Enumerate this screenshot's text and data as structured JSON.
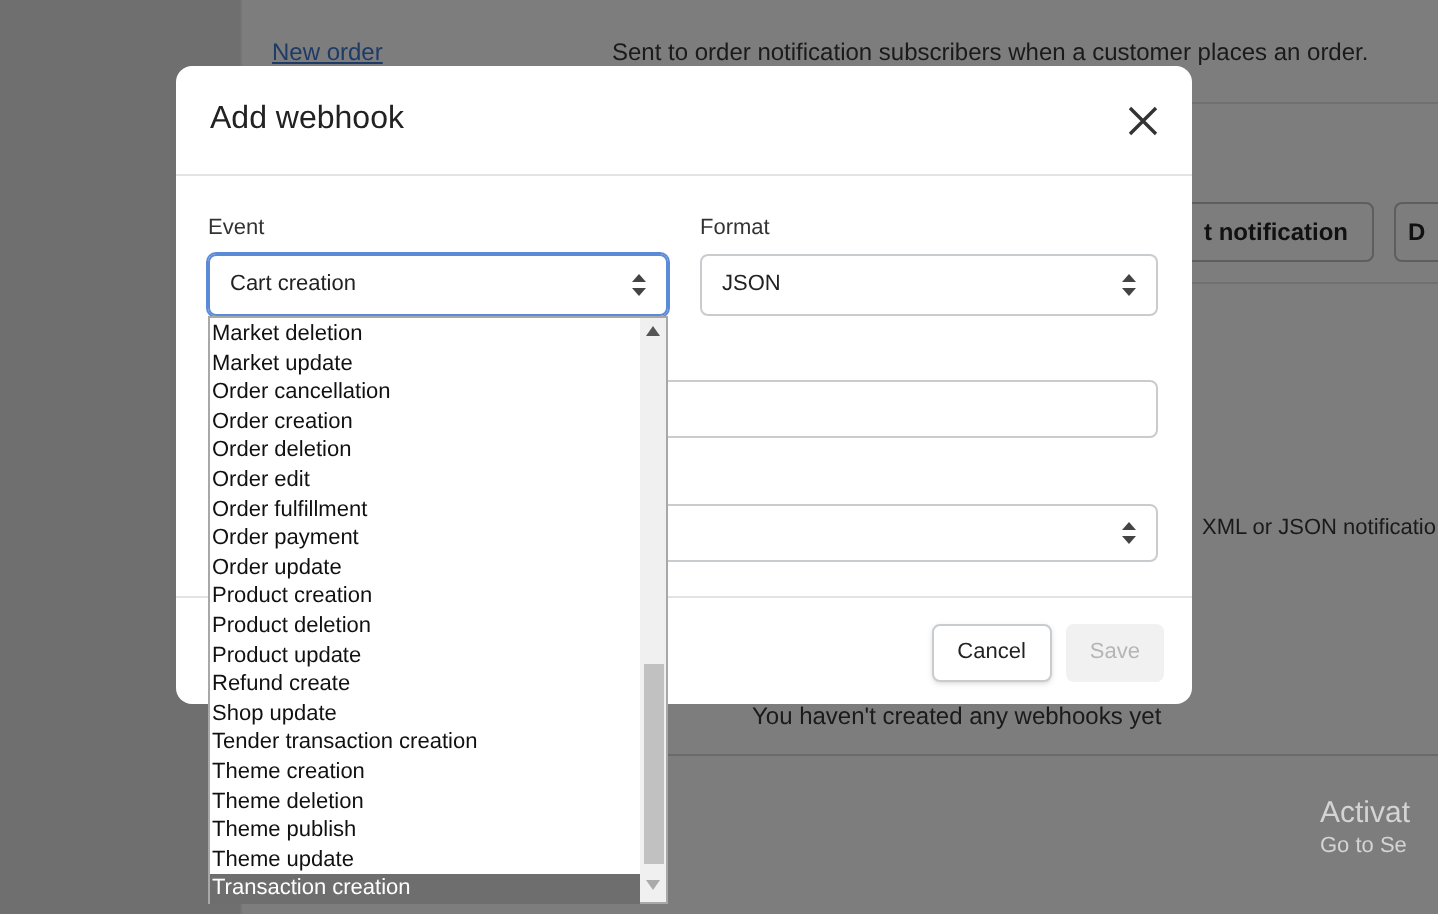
{
  "background": {
    "link": "New order",
    "description": "Sent to order notification subscribers when a customer places an order.",
    "button_1": "t notification",
    "button_2": "D",
    "format_note": "XML or JSON notificatio",
    "empty_state": "You haven't created any webhooks yet"
  },
  "dialog": {
    "title": "Add webhook",
    "event": {
      "label": "Event",
      "value": "Cart creation",
      "focused": true
    },
    "format": {
      "label": "Format",
      "value": "JSON"
    },
    "buttons": [
      {
        "label": "Cancel",
        "disabled": false
      },
      {
        "label": "Save",
        "disabled": true
      }
    ]
  },
  "event_options": [
    {
      "label": "Market deletion",
      "selected": false
    },
    {
      "label": "Market update",
      "selected": false
    },
    {
      "label": "Order cancellation",
      "selected": false
    },
    {
      "label": "Order creation",
      "selected": false
    },
    {
      "label": "Order deletion",
      "selected": false
    },
    {
      "label": "Order edit",
      "selected": false
    },
    {
      "label": "Order fulfillment",
      "selected": false
    },
    {
      "label": "Order payment",
      "selected": false
    },
    {
      "label": "Order update",
      "selected": false
    },
    {
      "label": "Product creation",
      "selected": false
    },
    {
      "label": "Product deletion",
      "selected": false
    },
    {
      "label": "Product update",
      "selected": false
    },
    {
      "label": "Refund create",
      "selected": false
    },
    {
      "label": "Shop update",
      "selected": false
    },
    {
      "label": "Tender transaction creation",
      "selected": false
    },
    {
      "label": "Theme creation",
      "selected": false
    },
    {
      "label": "Theme deletion",
      "selected": false
    },
    {
      "label": "Theme publish",
      "selected": false
    },
    {
      "label": "Theme update",
      "selected": false
    },
    {
      "label": "Transaction creation",
      "selected": true
    }
  ],
  "os_notice": {
    "title": "Activat",
    "subtitle": "Go to Se"
  }
}
